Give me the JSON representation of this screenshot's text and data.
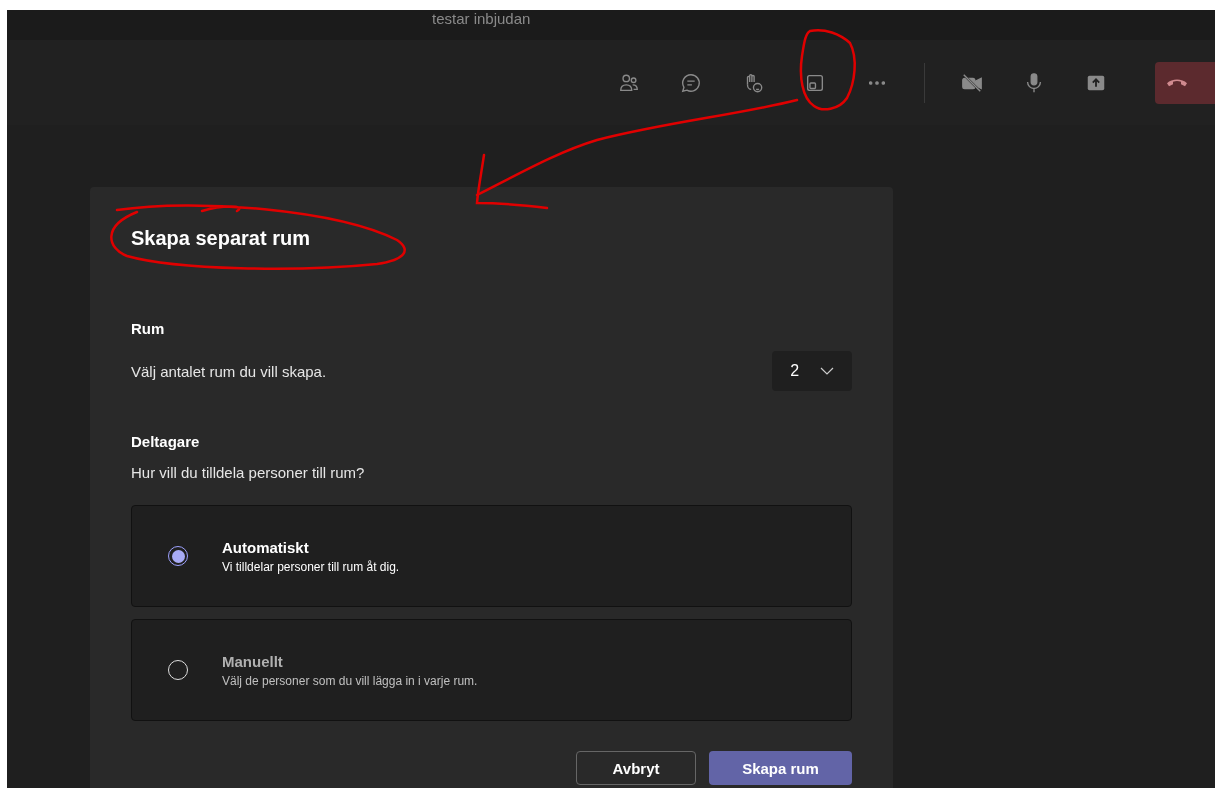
{
  "window": {
    "title": "testar inbjudan"
  },
  "dialog": {
    "title": "Skapa separat rum",
    "rooms": {
      "heading": "Rum",
      "prompt": "Välj antalet rum du vill skapa.",
      "count": "2"
    },
    "participants": {
      "heading": "Deltagare",
      "prompt": "Hur vill du tilldela personer till rum?",
      "options": [
        {
          "title": "Automatiskt",
          "description": "Vi tilldelar personer till rum åt dig.",
          "selected": true
        },
        {
          "title": "Manuellt",
          "description": "Välj de personer som du vill lägga in i varje rum.",
          "selected": false
        }
      ]
    },
    "buttons": [
      {
        "label": "Avbryt",
        "kind": "secondary"
      },
      {
        "label": "Skapa rum",
        "kind": "primary"
      }
    ]
  }
}
